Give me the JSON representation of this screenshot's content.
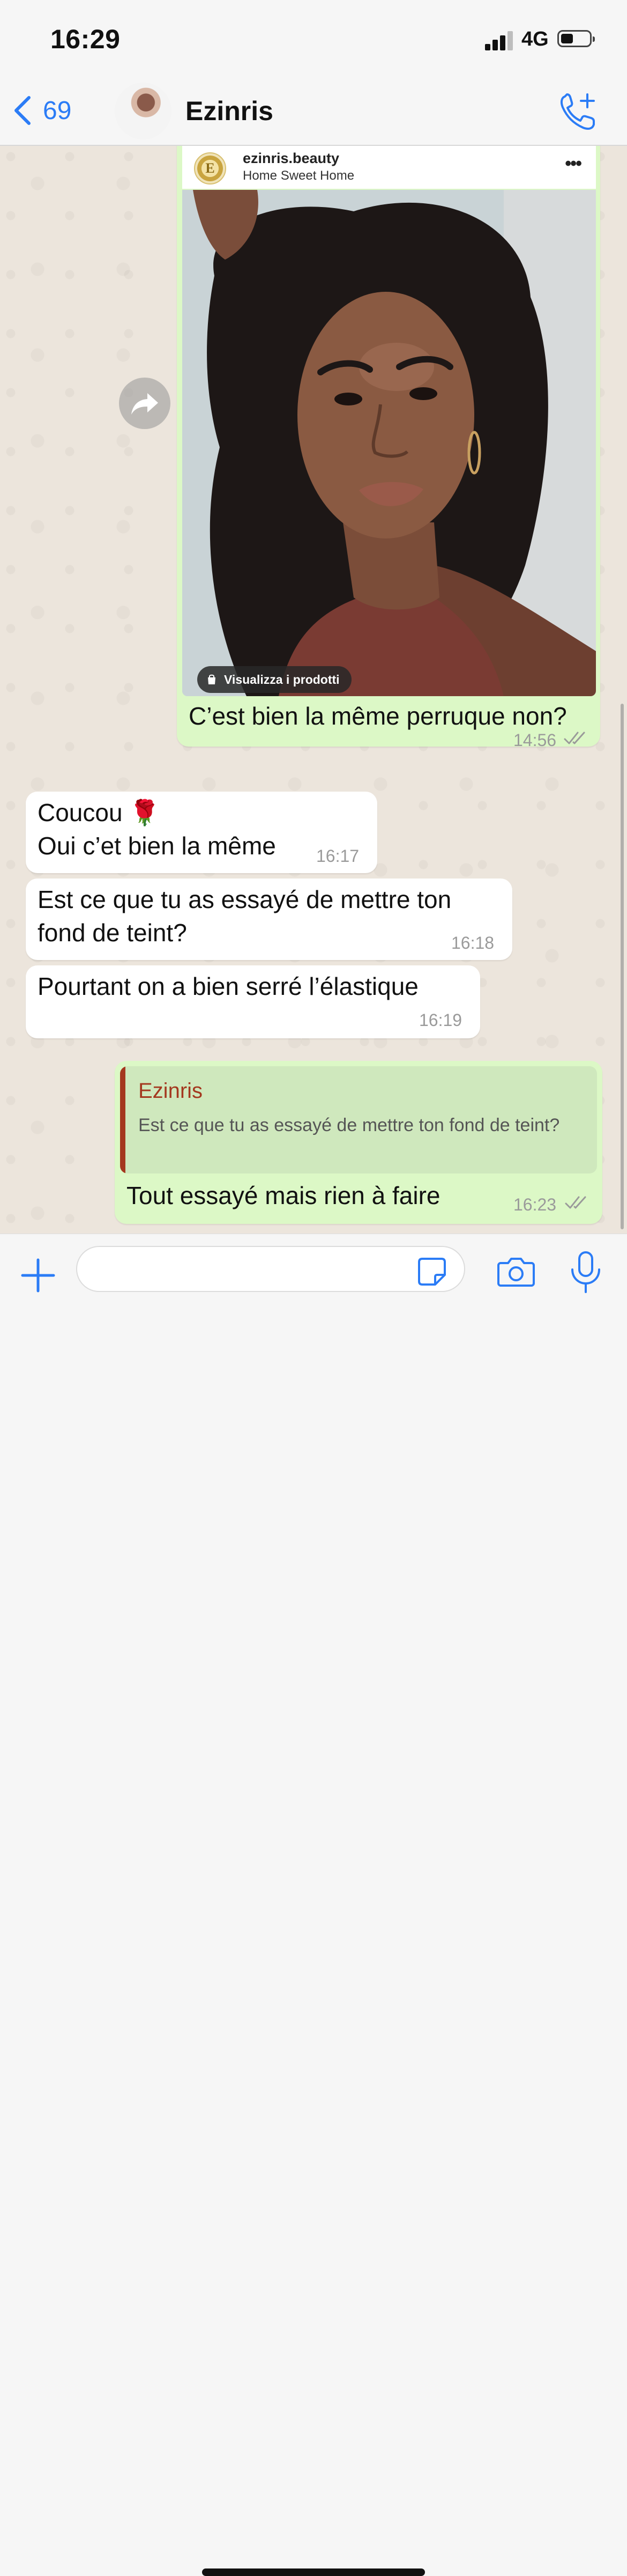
{
  "status_bar": {
    "time": "16:29",
    "network": "4G",
    "signal_bars": 3
  },
  "header": {
    "back_count": "69",
    "contact_name": "Ezinris"
  },
  "icons": {
    "back": "chevron-left-icon",
    "call": "phone-plus-icon",
    "share": "forward-arrow-icon",
    "add": "plus-icon",
    "sticker": "sticker-icon",
    "camera": "camera-icon",
    "mic": "microphone-icon",
    "ticks": "double-check-icon",
    "bag": "shopping-bag-icon"
  },
  "colors": {
    "accent": "#2b7cf6",
    "outgoing_bubble": "#dcf8c6",
    "incoming_bubble": "#ffffff",
    "quote_name": "#a4381f",
    "chat_background": "#ece5dc"
  },
  "forwarded_post": {
    "account": "ezinris.beauty",
    "subtitle": "Home Sweet Home",
    "more_label": "•••",
    "logo_letter": "E",
    "products_button": "Visualizza i prodotti",
    "caption": "C’est bien la même perruque non?",
    "time": "14:56"
  },
  "messages": [
    {
      "direction": "in",
      "lines": [
        "Coucou 🌹",
        "Oui c’et bien la même"
      ],
      "time": "16:17"
    },
    {
      "direction": "in",
      "lines": [
        "Est ce que tu as essayé de mettre ton",
        "fond de teint?"
      ],
      "time": "16:18"
    },
    {
      "direction": "in",
      "lines": [
        "Pourtant on a bien serré l’élastique"
      ],
      "time": "16:19"
    },
    {
      "direction": "out",
      "quote": {
        "name": "Ezinris",
        "text": "Est ce que tu as essayé de mettre ton fond de teint?"
      },
      "text": "Tout essayé mais rien à faire",
      "time": "16:23"
    }
  ],
  "composer": {
    "value": "",
    "placeholder": ""
  }
}
